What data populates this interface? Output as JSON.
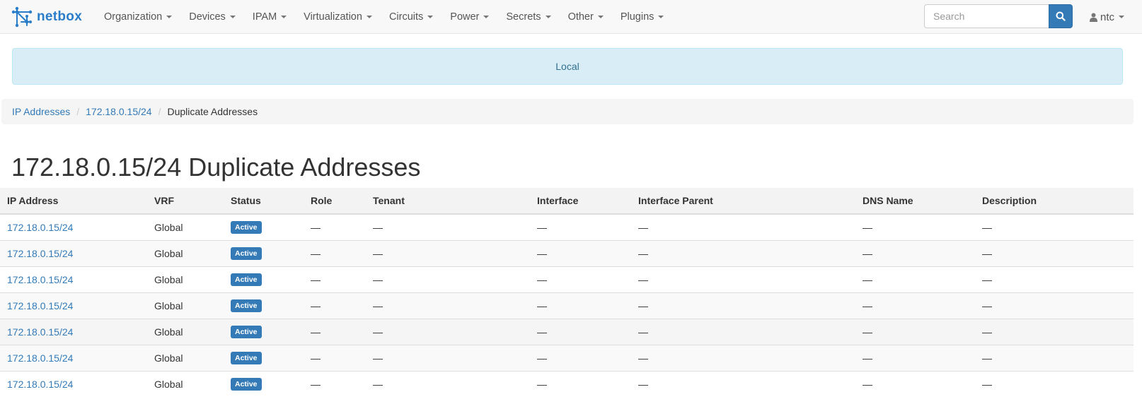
{
  "navbar": {
    "brand": "netbox",
    "menu": [
      "Organization",
      "Devices",
      "IPAM",
      "Virtualization",
      "Circuits",
      "Power",
      "Secrets",
      "Other",
      "Plugins"
    ],
    "search_placeholder": "Search",
    "user": "ntc"
  },
  "alert": {
    "text": "Local"
  },
  "breadcrumb": {
    "items": [
      "IP Addresses",
      "172.18.0.15/24"
    ],
    "active": "Duplicate Addresses"
  },
  "page_title": "172.18.0.15/24 Duplicate Addresses",
  "table": {
    "columns": [
      "IP Address",
      "VRF",
      "Status",
      "Role",
      "Tenant",
      "Interface",
      "Interface Parent",
      "DNS Name",
      "Description"
    ],
    "rows": [
      {
        "ip": "172.18.0.15/24",
        "vrf": "Global",
        "status": "Active",
        "role": "—",
        "tenant": "—",
        "interface": "—",
        "parent": "—",
        "dns": "—",
        "description": "—"
      },
      {
        "ip": "172.18.0.15/24",
        "vrf": "Global",
        "status": "Active",
        "role": "—",
        "tenant": "—",
        "interface": "—",
        "parent": "—",
        "dns": "—",
        "description": "—"
      },
      {
        "ip": "172.18.0.15/24",
        "vrf": "Global",
        "status": "Active",
        "role": "—",
        "tenant": "—",
        "interface": "—",
        "parent": "—",
        "dns": "—",
        "description": "—"
      },
      {
        "ip": "172.18.0.15/24",
        "vrf": "Global",
        "status": "Active",
        "role": "—",
        "tenant": "—",
        "interface": "—",
        "parent": "—",
        "dns": "—",
        "description": "—"
      },
      {
        "ip": "172.18.0.15/24",
        "vrf": "Global",
        "status": "Active",
        "role": "—",
        "tenant": "—",
        "interface": "—",
        "parent": "—",
        "dns": "—",
        "description": "—"
      },
      {
        "ip": "172.18.0.15/24",
        "vrf": "Global",
        "status": "Active",
        "role": "—",
        "tenant": "—",
        "interface": "—",
        "parent": "—",
        "dns": "—",
        "description": "—"
      },
      {
        "ip": "172.18.0.15/24",
        "vrf": "Global",
        "status": "Active",
        "role": "—",
        "tenant": "—",
        "interface": "—",
        "parent": "—",
        "dns": "—",
        "description": "—"
      }
    ]
  },
  "colors": {
    "brand": "#2a7dc9",
    "link": "#337ab7",
    "alert_bg": "#d9edf7",
    "badge_active": "#337ab7"
  }
}
